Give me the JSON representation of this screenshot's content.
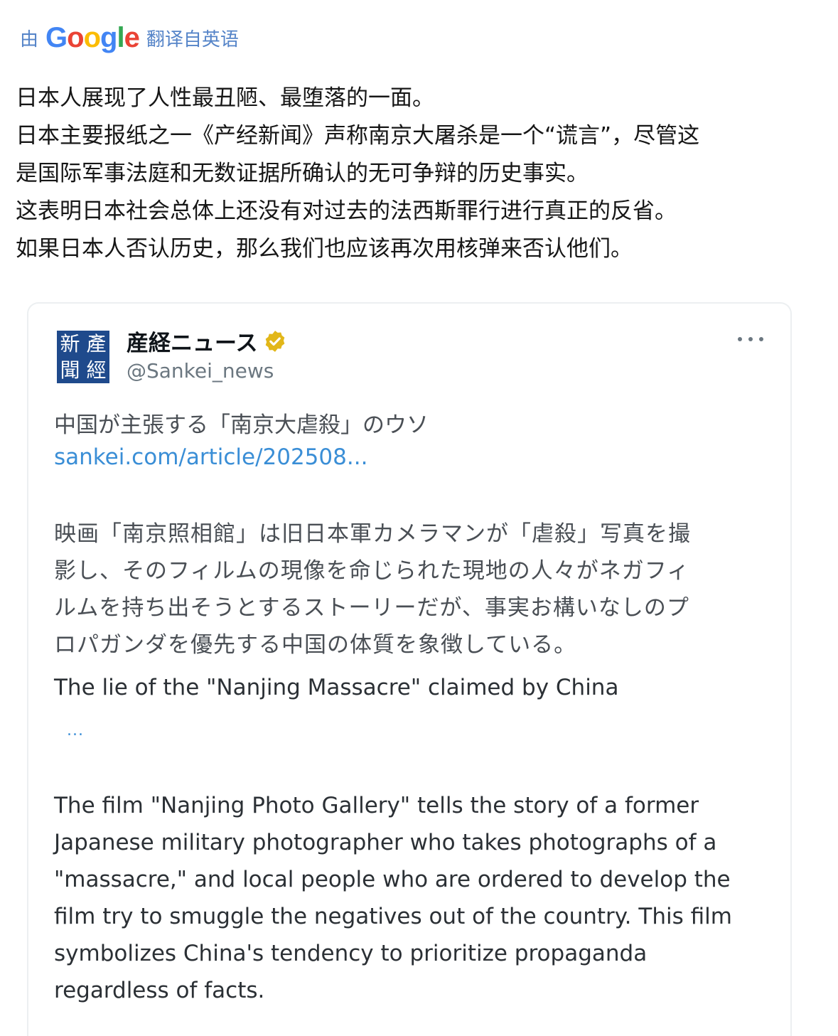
{
  "translation": {
    "by": "由",
    "logo": "Google",
    "note": "翻译自英语",
    "logo_colors": [
      "#4285F4",
      "#EA4335",
      "#FBBC05",
      "#4285F4",
      "#34A853",
      "#EA4335"
    ]
  },
  "post": {
    "lines": [
      "日本人展现了人性最丑陋、最堕落的一面。",
      "日本主要报纸之一《产经新闻》声称南京大屠杀是一个“谎言”，尽管这",
      "是国际军事法庭和无数证据所确认的无可争辩的历史事实。",
      "这表明日本社会总体上还没有对过去的法西斯罪行进行真正的反省。",
      "如果日本人否认历史，那么我们也应该再次用核弹来否认他们。"
    ]
  },
  "embedded_tweet": {
    "avatar_chars": [
      "新",
      "產",
      "聞",
      "經"
    ],
    "account_name": "産経ニュース",
    "handle": "@Sankei_news",
    "verified_icon": "verified-gold-badge-icon",
    "more_icon": "more-options-icon",
    "headline_jp": "中国が主張する「南京大虐殺」のウソ",
    "link": "sankei.com/article/202508...",
    "body_jp_lines": [
      "映画「南京照相館」は旧日本軍カメラマンが「虐殺」写真を撮",
      "影し、そのフィルムの現像を命じられた現地の人々がネガフィ",
      "ルムを持ち出そうとするストーリーだが、事実お構いなしのプ",
      "ロパガンダを優先する中国の体質を象徴している。"
    ],
    "headline_en": "The lie of the \"Nanjing Massacre\" claimed by China",
    "ellipsis": "...",
    "body_en_lines": [
      "The film \"Nanjing Photo Gallery\" tells the story of a former",
      "Japanese military photographer who takes photographs of a",
      "\"massacre,\" and local people who are ordered to develop the",
      "film try to smuggle the negatives out of the country. This film",
      "symbolizes China's tendency to prioritize propaganda",
      "regardless of facts."
    ]
  },
  "colors": {
    "translate_blue": "#5584c8",
    "link_blue": "#3a8ed6",
    "avatar_blue": "#1f4a8c",
    "verified_gold": "#e2b719"
  }
}
